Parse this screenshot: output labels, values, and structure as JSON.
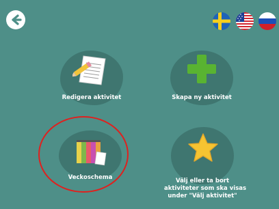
{
  "colors": {
    "background": "#4e8f88",
    "tile_blob": "#3f7670",
    "highlight": "#e0201e",
    "plus": "#59b331",
    "star": "#f6c432"
  },
  "header": {
    "back_icon": "arrow-left-icon",
    "languages": [
      "Swedish flag",
      "US flag",
      "Russian flag"
    ]
  },
  "tiles": [
    {
      "label": "Redigera aktivitet",
      "icon": "edit-document-pencil-icon"
    },
    {
      "label": "Skapa ny aktivitet",
      "icon": "plus-icon"
    },
    {
      "label": "Veckoschema",
      "icon": "weekly-schedule-binders-icon"
    },
    {
      "label_lines": [
        "Välj eller ta bort",
        "aktiviteter som ska visas",
        "under \"Välj aktivitet\""
      ],
      "icon": "star-icon"
    }
  ]
}
